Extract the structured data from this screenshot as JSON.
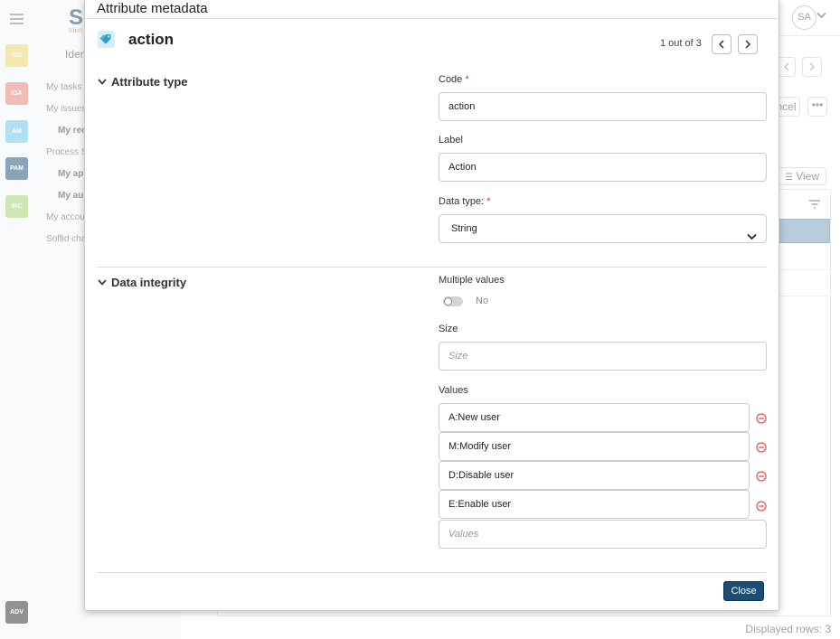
{
  "background": {
    "rail_tiles": [
      {
        "label": "ISS",
        "color": "#e8d36a"
      },
      {
        "label": "IGA",
        "color": "#e8847a"
      },
      {
        "label": "AM",
        "color": "#6fc6e8"
      },
      {
        "label": "PAM",
        "color": "#2a5a7c"
      },
      {
        "label": "IRC",
        "color": "#a6cf7a"
      }
    ],
    "rail_bottom": {
      "label": "ADV",
      "color": "#3a3a3a"
    },
    "logo_letter": "S",
    "logo_sub": "Iden",
    "nav_title": "Ident",
    "nav_items": [
      "My tasks",
      "My issues",
      "My rec",
      "Process S",
      "My ap",
      "My au",
      "My accou",
      "Soffid cha"
    ],
    "avatar": "SA",
    "cancel_label": "ncel",
    "view_label": "View",
    "displayed_rows": "Displayed rows: 3"
  },
  "dialog": {
    "title": "Attribute metadata",
    "record_name": "action",
    "pager": "1 out of 3",
    "sections": {
      "attribute_type": "Attribute type",
      "data_integrity": "Data integrity"
    },
    "fields": {
      "code_label": "Code",
      "code_value": "action",
      "label_label": "Label",
      "label_value": "Action",
      "datatype_label": "Data type:",
      "datatype_value": "String",
      "multiple_label": "Multiple values",
      "multiple_value": "No",
      "size_label": "Size",
      "size_placeholder": "Size",
      "values_label": "Values",
      "values": [
        "A:New user",
        "M:Modify user",
        "D:Disable user",
        "E:Enable user"
      ],
      "values_placeholder": "Values"
    },
    "required_mark": "*",
    "close_label": "Close"
  },
  "colors": {
    "primary": "#1c4d72",
    "remove": "#d9534f",
    "tag_icon": "#2a9fd0"
  }
}
